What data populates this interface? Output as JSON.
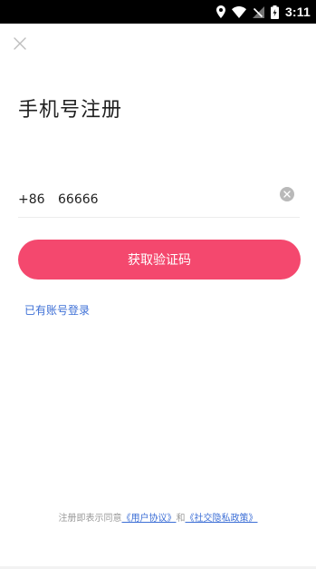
{
  "status_bar": {
    "time": "3:11",
    "icons": [
      "location-icon",
      "wifi-icon",
      "signal-icon",
      "battery-icon"
    ]
  },
  "header": {
    "close_icon": "close-icon",
    "title": "手机号注册"
  },
  "phone": {
    "country_code": "+86",
    "value": "66666",
    "clear_icon": "clear-icon"
  },
  "actions": {
    "get_code_label": "获取验证码",
    "login_link_label": "已有账号登录"
  },
  "agreement": {
    "prefix": "注册即表示同意",
    "user_agreement": "《用户协议》",
    "and": "和",
    "privacy_policy": "《社交隐私政策》"
  },
  "colors": {
    "accent": "#f4486e",
    "link": "#3d6fd6",
    "status_bar_bg": "#000000"
  }
}
